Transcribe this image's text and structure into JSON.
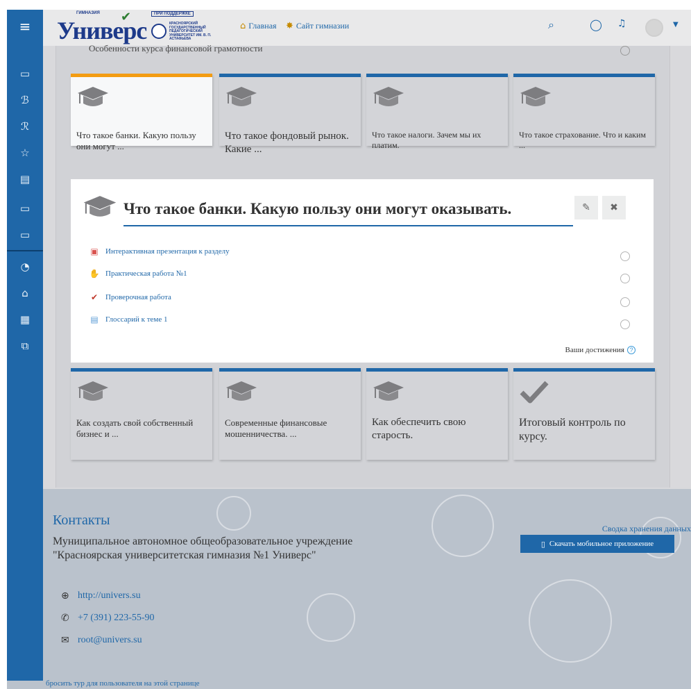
{
  "navbar": {
    "logo": {
      "word": "Универс",
      "gym_label": "ГИМНАЗИЯ",
      "support_label": "ПРИ ПОДДЕРЖКЕ",
      "university": "КРАСНОЯРСКИЙ ГОСУДАРСТВЕННЫЙ ПЕДАГОГИЧЕСКИЙ УНИВЕРСИТЕТ ИМ. В. П. АСТАФЬЕВА"
    },
    "home_label": "Главная",
    "site_label": "Сайт гимназии",
    "icons": [
      "search-icon",
      "chat-icon",
      "bell-icon",
      "avatar",
      "chevron-down-icon"
    ]
  },
  "sidebar": {
    "items": [
      {
        "name": "hamburger-icon",
        "glyph": "≡"
      },
      {
        "name": "folder-icon",
        "glyph": "▭"
      },
      {
        "name": "users-icon",
        "glyph": "ℬ"
      },
      {
        "name": "badge-icon",
        "glyph": "ℛ"
      },
      {
        "name": "star-icon",
        "glyph": "☆"
      },
      {
        "name": "book-icon",
        "glyph": "▤"
      },
      {
        "name": "folder-icon",
        "glyph": "▭"
      },
      {
        "name": "folder-icon",
        "glyph": "▭"
      },
      {
        "name": "dashboard-icon",
        "glyph": "◔"
      },
      {
        "name": "home-icon",
        "glyph": "⌂"
      },
      {
        "name": "calendar-icon",
        "glyph": "▦"
      },
      {
        "name": "files-icon",
        "glyph": "⧉"
      }
    ]
  },
  "previous_row": {
    "text": "Особенности курса финансовой грамотности"
  },
  "tiles_top": [
    {
      "title": "Что такое банки. Какую пользу они могут ...",
      "active": true
    },
    {
      "title": "Что такое фондовый рынок. Какие ...",
      "active": false
    },
    {
      "title": "Что такое налоги. Зачем мы их платим.",
      "active": false
    },
    {
      "title": "Что такое страхование. Что и каким ...",
      "active": false
    }
  ],
  "section": {
    "title": "Что такое банки. Какую пользу они могут оказывать.",
    "edit_icon": "pencil-icon",
    "close_icon": "close-icon",
    "activities": [
      {
        "label": "Интерактивная презентация к разделу",
        "icon": "presentation-icon"
      },
      {
        "label": "Практическая работа №1",
        "icon": "assignment-icon"
      },
      {
        "label": "Проверочная работа",
        "icon": "quiz-icon"
      },
      {
        "label": "Глоссарий к теме 1",
        "icon": "glossary-icon"
      }
    ],
    "achievements": "Ваши достижения"
  },
  "tiles_bottom": [
    {
      "title": "Как создать свой собственный бизнес и ...",
      "icon": "graduation-cap-icon"
    },
    {
      "title": "Современные финансовые мошенничества. ...",
      "icon": "graduation-cap-icon"
    },
    {
      "title": "Как обеспечить свою старость.",
      "icon": "graduation-cap-icon"
    },
    {
      "title": "Итоговый контроль по курсу.",
      "icon": "checkmark-icon"
    }
  ],
  "footer": {
    "heading": "Контакты",
    "organization": "Муниципальное автономное общеобразовательное учреждение \"Красноярская университетская гимназия №1 Универс\"",
    "website": "http://univers.su",
    "phone": "+7 (391) 223-55-90",
    "email": "root@univers.su",
    "data_retention": "Сводка хранения данных",
    "app_button": "Скачать мобильное приложение",
    "tour_reset": "бросить тур для пользователя на этой странице"
  },
  "colors": {
    "brand_blue": "#1f67a8",
    "active_orange": "#f39c12",
    "tile_gray": "#d3d4d8",
    "footer_gray": "#bac2cc"
  }
}
